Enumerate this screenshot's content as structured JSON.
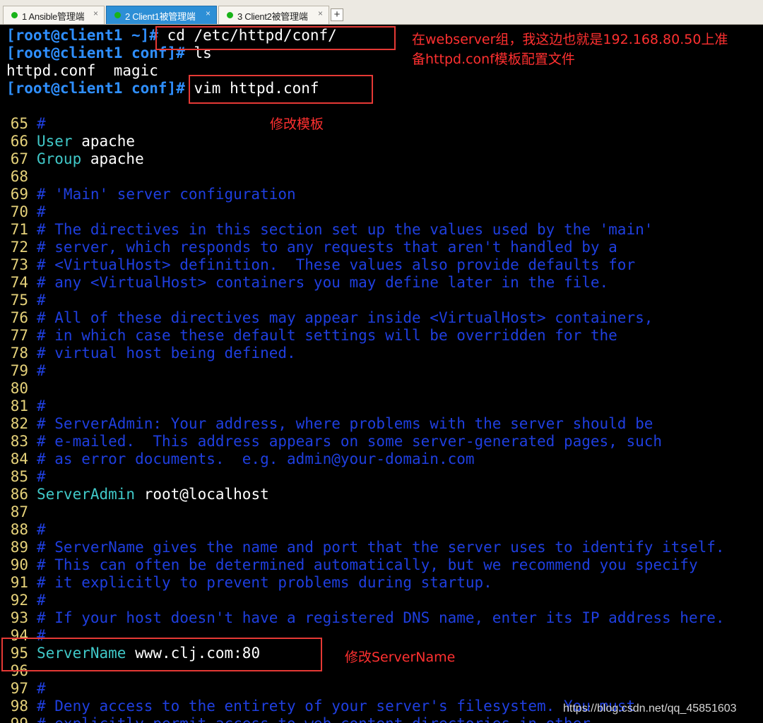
{
  "tabs": [
    {
      "label": "1 Ansible管理端"
    },
    {
      "label": "2 Client1被管理端"
    },
    {
      "label": "3 Client2被管理端"
    }
  ],
  "tab_add_label": "+",
  "tab_close_glyph": "×",
  "commands": [
    {
      "prompt": "[root@client1 ~]#",
      "cmd": " cd /etc/httpd/conf/"
    },
    {
      "prompt": "[root@client1 conf]#",
      "cmd": " ls"
    },
    {
      "output": "httpd.conf  magic"
    },
    {
      "prompt": "[root@client1 conf]#",
      "cmd": " vim httpd.conf"
    }
  ],
  "file_lines": [
    {
      "n": "65",
      "text": "#"
    },
    {
      "n": "66",
      "key": "User",
      "val": " apache"
    },
    {
      "n": "67",
      "key": "Group",
      "val": " apache"
    },
    {
      "n": "68",
      "text": ""
    },
    {
      "n": "69",
      "text": "# 'Main' server configuration"
    },
    {
      "n": "70",
      "text": "#"
    },
    {
      "n": "71",
      "text": "# The directives in this section set up the values used by the 'main'"
    },
    {
      "n": "72",
      "text": "# server, which responds to any requests that aren't handled by a"
    },
    {
      "n": "73",
      "text": "# <VirtualHost> definition.  These values also provide defaults for"
    },
    {
      "n": "74",
      "text": "# any <VirtualHost> containers you may define later in the file."
    },
    {
      "n": "75",
      "text": "#"
    },
    {
      "n": "76",
      "text": "# All of these directives may appear inside <VirtualHost> containers,"
    },
    {
      "n": "77",
      "text": "# in which case these default settings will be overridden for the"
    },
    {
      "n": "78",
      "text": "# virtual host being defined."
    },
    {
      "n": "79",
      "text": "#"
    },
    {
      "n": "80",
      "text": ""
    },
    {
      "n": "81",
      "text": "#"
    },
    {
      "n": "82",
      "text": "# ServerAdmin: Your address, where problems with the server should be"
    },
    {
      "n": "83",
      "text": "# e-mailed.  This address appears on some server-generated pages, such"
    },
    {
      "n": "84",
      "text": "# as error documents.  e.g. admin@your-domain.com"
    },
    {
      "n": "85",
      "text": "#"
    },
    {
      "n": "86",
      "key": "ServerAdmin",
      "val": " root@localhost"
    },
    {
      "n": "87",
      "text": ""
    },
    {
      "n": "88",
      "text": "#"
    },
    {
      "n": "89",
      "text": "# ServerName gives the name and port that the server uses to identify itself."
    },
    {
      "n": "90",
      "text": "# This can often be determined automatically, but we recommend you specify"
    },
    {
      "n": "91",
      "text": "# it explicitly to prevent problems during startup."
    },
    {
      "n": "92",
      "text": "#"
    },
    {
      "n": "93",
      "text": "# If your host doesn't have a registered DNS name, enter its IP address here."
    },
    {
      "n": "94",
      "text": "#"
    },
    {
      "n": "95",
      "key": "ServerName",
      "val": " www.clj.com:80"
    },
    {
      "n": "96",
      "text": ""
    },
    {
      "n": "97",
      "text": "#"
    },
    {
      "n": "98",
      "text": "# Deny access to the entirety of your server's filesystem. You must"
    },
    {
      "n": "99",
      "text": "# explicitly permit access to web content directories in other"
    }
  ],
  "annotations": {
    "note1_line1": "在webserver组，我这边也就是192.168.80.50上准",
    "note1_line2": "备httpd.conf模板配置文件",
    "note2": "修改模板",
    "note3": "修改ServerName"
  },
  "watermark": "https://blog.csdn.net/qq_45851603",
  "colors": {
    "prompt": "#2f8fff",
    "line_number": "#e6d27a",
    "comment": "#1f3fe0",
    "keyword": "#40c8c8",
    "annotation": "#ff3030",
    "active_tab": "#2d8fd6"
  }
}
